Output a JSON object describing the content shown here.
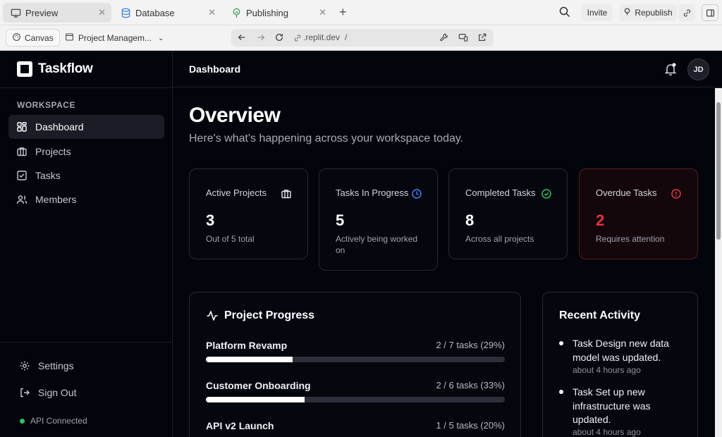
{
  "browser": {
    "tabs": [
      {
        "label": "Preview",
        "icon": "monitor-icon"
      },
      {
        "label": "Database",
        "icon": "database-icon"
      },
      {
        "label": "Publishing",
        "icon": "publish-icon"
      }
    ],
    "invite_label": "Invite",
    "republish_label": "Republish",
    "canvas_label": "Canvas",
    "project_label": "Project Managem...",
    "url": ".replit.dev",
    "url_path": "/"
  },
  "sidebar": {
    "brand": "Taskflow",
    "section_label": "WORKSPACE",
    "items": [
      {
        "label": "Dashboard",
        "icon": "dashboard-icon",
        "active": true
      },
      {
        "label": "Projects",
        "icon": "briefcase-icon"
      },
      {
        "label": "Tasks",
        "icon": "checkbox-icon"
      },
      {
        "label": "Members",
        "icon": "users-icon"
      }
    ],
    "settings_label": "Settings",
    "signout_label": "Sign Out",
    "api_status": "API Connected"
  },
  "header": {
    "breadcrumb": "Dashboard",
    "avatar_initials": "JD"
  },
  "overview": {
    "title": "Overview",
    "subtitle": "Here's what's happening across your workspace today."
  },
  "stats": [
    {
      "label": "Active Projects",
      "value": "3",
      "note": "Out of 5 total",
      "icon": "briefcase-icon"
    },
    {
      "label": "Tasks In Progress",
      "value": "5",
      "note": "Actively being worked on",
      "icon": "clock-icon"
    },
    {
      "label": "Completed Tasks",
      "value": "8",
      "note": "Across all projects",
      "icon": "check-circle-icon"
    },
    {
      "label": "Overdue Tasks",
      "value": "2",
      "note": "Requires attention",
      "icon": "alert-circle-icon"
    }
  ],
  "project_progress": {
    "title": "Project Progress",
    "projects": [
      {
        "name": "Platform Revamp",
        "stat": "2 / 7 tasks (29%)",
        "progress": 0.29
      },
      {
        "name": "Customer Onboarding",
        "stat": "2 / 6 tasks (33%)",
        "progress": 0.33
      },
      {
        "name": "API v2 Launch",
        "stat": "1 / 5 tasks (20%)",
        "progress": 0.2
      }
    ]
  },
  "recent_activity": {
    "title": "Recent Activity",
    "items": [
      {
        "text": "Task Design new data model was updated.",
        "time": "about 4 hours ago"
      },
      {
        "text": "Task Set up new infrastructure was updated.",
        "time": "about 4 hours ago"
      }
    ]
  },
  "colors": {
    "background": "#03050c",
    "danger": "#e5343d",
    "success": "#22c55e",
    "info": "#3b82f6"
  }
}
